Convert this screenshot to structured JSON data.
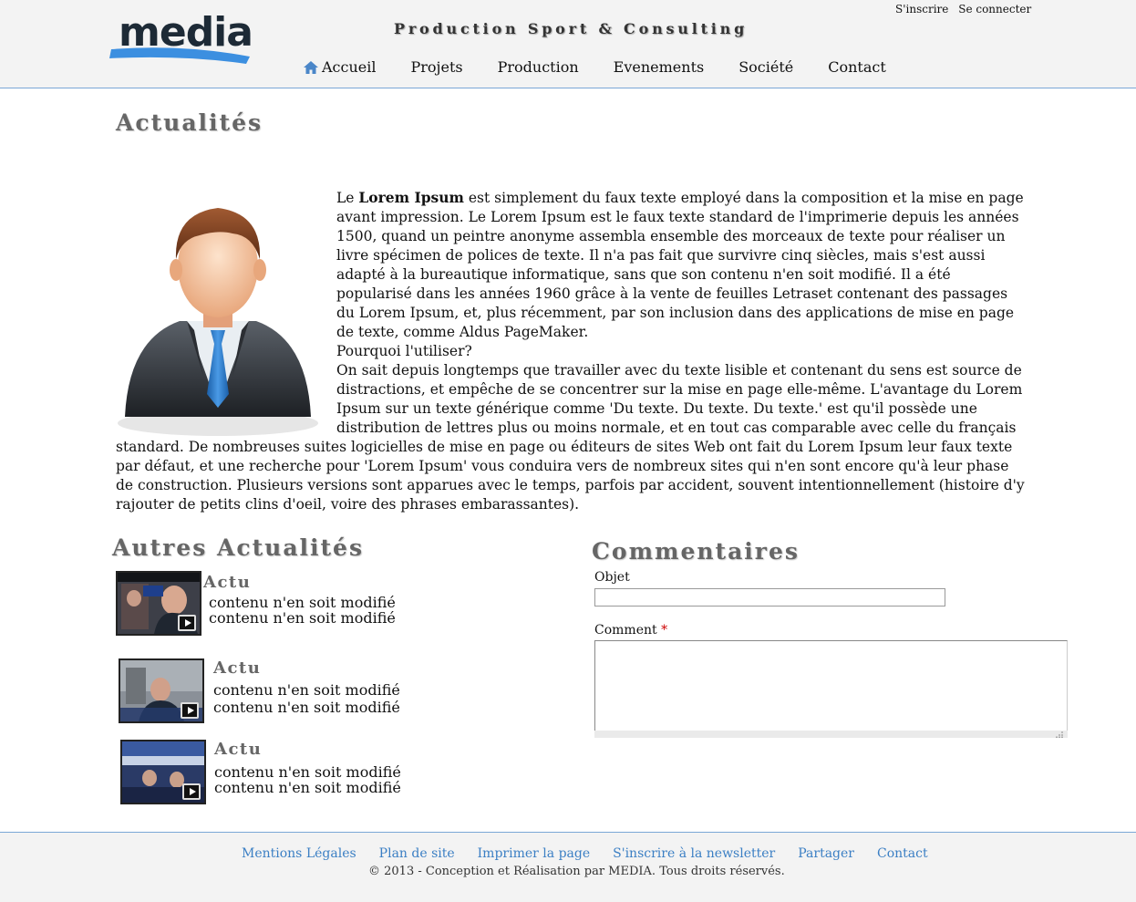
{
  "header": {
    "logo_text": "media",
    "tagline": "Production Sport & Consulting",
    "signup_link": "S'inscrire",
    "login_link": "Se connecter",
    "nav": [
      "Accueil",
      "Projets",
      "Production",
      "Evenements",
      "Société",
      "Contact"
    ],
    "home_icon": "home-icon"
  },
  "main": {
    "title": "Actualités",
    "article": {
      "intro_prefix": "Le ",
      "intro_bold": "Lorem Ipsum",
      "intro_rest": " est simplement du faux texte employé dans la composition et la mise en page avant impression. Le Lorem Ipsum est le faux texte standard de l'imprimerie depuis les années 1500, quand un peintre anonyme assembla ensemble des morceaux de texte pour réaliser un livre spécimen de polices de texte. Il n'a pas fait que survivre cinq siècles, mais s'est aussi adapté à la bureautique informatique, sans que son contenu n'en soit modifié. Il a été popularisé dans les années 1960 grâce à la vente de feuilles Letraset contenant des passages du Lorem Ipsum, et, plus récemment, par son inclusion dans des applications de mise en page de texte, comme Aldus PageMaker.",
      "question": "Pourquoi l'utiliser?",
      "body": "On sait depuis longtemps que travailler avec du texte lisible et contenant du sens est source de distractions, et empêche de se concentrer sur la mise en page elle-même. L'avantage du Lorem Ipsum sur un texte générique comme 'Du texte. Du texte. Du texte.' est qu'il possède une distribution de lettres plus ou moins normale, et en tout cas comparable avec celle du français standard. De nombreuses suites logicielles de mise en page ou éditeurs de sites Web ont fait du Lorem Ipsum leur faux texte par défaut, et une recherche pour 'Lorem Ipsum' vous conduira vers de nombreux sites qui n'en sont encore qu'à leur phase de construction. Plusieurs versions sont apparues avec le temps, parfois par accident, souvent intentionnellement (histoire d'y rajouter de petits clins d'oeil, voire des phrases embarassantes)."
    }
  },
  "other_news": {
    "title": "Autres Actualités",
    "items": [
      {
        "title": "Actu",
        "line1": "contenu n'en soit modifié",
        "line2": "contenu n'en soit modifié"
      },
      {
        "title": "Actu",
        "line1": "contenu n'en soit modifié",
        "line2": "contenu n'en soit modifié"
      },
      {
        "title": "Actu",
        "line1": "contenu n'en soit modifié",
        "line2": "contenu n'en soit modifié"
      }
    ]
  },
  "comments": {
    "title": "Commentaires",
    "objet_label": "Objet",
    "objet_value": "",
    "comment_label": "Comment",
    "required_mark": "*",
    "comment_value": ""
  },
  "footer": {
    "links": [
      "Mentions Légales",
      "Plan de site",
      "Imprimer la page",
      "S'inscrire à la newsletter",
      "Partager",
      "Contact"
    ],
    "copyright": "© 2013 - Conception et Réalisation par MEDIA. Tous droits réservés."
  },
  "colors": {
    "accent": "#3b7fc4",
    "header_bg": "#f3f3f3",
    "title_gray": "#666666",
    "required": "#cc0000"
  }
}
